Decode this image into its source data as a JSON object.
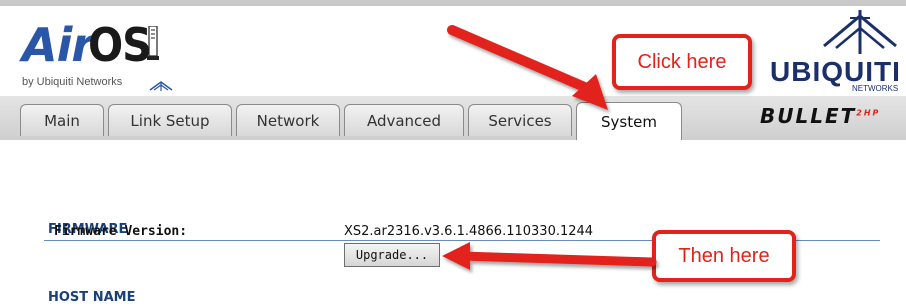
{
  "header": {
    "logo_air": "Air",
    "logo_os": "OS",
    "logo_sub": "by Ubiquiti Networks",
    "brand": "UBIQUITI",
    "brand_sub": "NETWORKS"
  },
  "tabs": [
    {
      "label": "Main"
    },
    {
      "label": "Link Setup"
    },
    {
      "label": "Network"
    },
    {
      "label": "Advanced"
    },
    {
      "label": "Services"
    },
    {
      "label": "System",
      "active": true
    }
  ],
  "product": "BULLET",
  "product_suffix": "2HP",
  "annotations": {
    "click_here": "Click here",
    "then_here": "Then here"
  },
  "firmware": {
    "section": "FIRMWARE",
    "version_label": "Firmware Version:",
    "version_value": "XS2.ar2316.v3.6.1.4866.110330.1244",
    "upgrade_label": "Upgrade..."
  },
  "hostname": {
    "section": "HOST NAME"
  },
  "colors": {
    "callout_red": "#e2231a",
    "section_blue": "#1b3f7a",
    "logo_blue": "#2a56a8"
  }
}
